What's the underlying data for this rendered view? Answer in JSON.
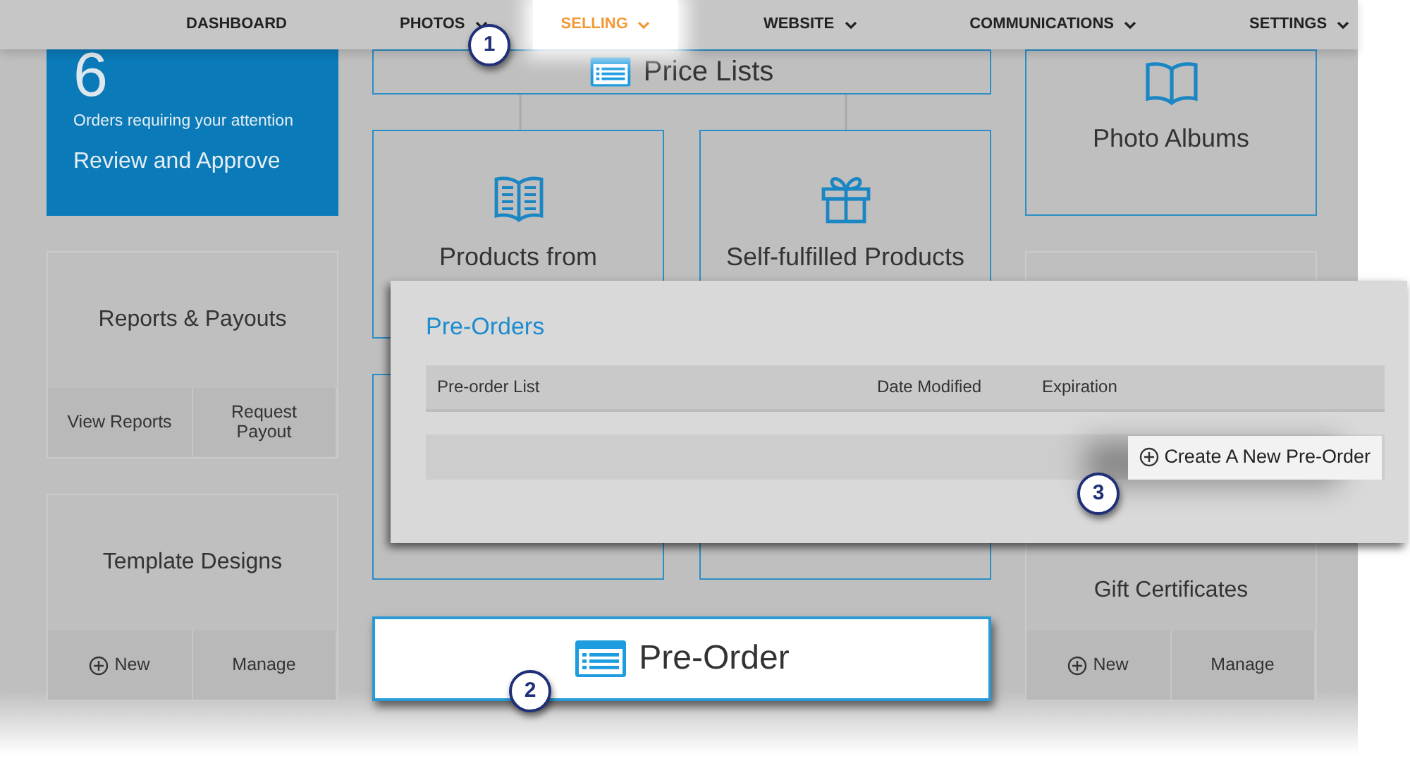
{
  "nav": [
    {
      "label": "DASHBOARD",
      "dropdown": false,
      "selected": false
    },
    {
      "label": "PHOTOS",
      "dropdown": true,
      "selected": false
    },
    {
      "label": "SELLING",
      "dropdown": true,
      "selected": true
    },
    {
      "label": "WEBSITE",
      "dropdown": true,
      "selected": false
    },
    {
      "label": "COMMUNICATIONS",
      "dropdown": true,
      "selected": false
    },
    {
      "label": "SETTINGS",
      "dropdown": true,
      "selected": false
    }
  ],
  "orders_card": {
    "count": "6",
    "caption": "Orders requiring your attention",
    "action": "Review and Approve"
  },
  "reports_card": {
    "title": "Reports & Payouts",
    "actions": [
      {
        "label": "View Reports",
        "kind": "plain"
      },
      {
        "label": "Request Payout",
        "kind": "plain"
      }
    ]
  },
  "template_card": {
    "title": "Template Designs",
    "actions": [
      {
        "label": "New",
        "kind": "add"
      },
      {
        "label": "Manage",
        "kind": "plain"
      }
    ]
  },
  "price_lists": {
    "title": "Price Lists"
  },
  "product_tiles": [
    {
      "title": "Products from"
    },
    {
      "title": "Self-fulfilled Products"
    }
  ],
  "pre_order_tile": {
    "title": "Pre-Order",
    "highlighted": true
  },
  "photo_albums": {
    "title": "Photo Albums"
  },
  "gift_card": {
    "title": "Gift Certificates",
    "actions": [
      {
        "label": "New",
        "kind": "add"
      },
      {
        "label": "Manage",
        "kind": "plain"
      }
    ]
  },
  "popup": {
    "title": "Pre-Orders",
    "columns": [
      "Pre-order List",
      "Date Modified",
      "Expiration"
    ],
    "create_button": "Create A New Pre-Order"
  },
  "callouts": [
    {
      "number": "1"
    },
    {
      "number": "2"
    },
    {
      "number": "3"
    }
  ]
}
